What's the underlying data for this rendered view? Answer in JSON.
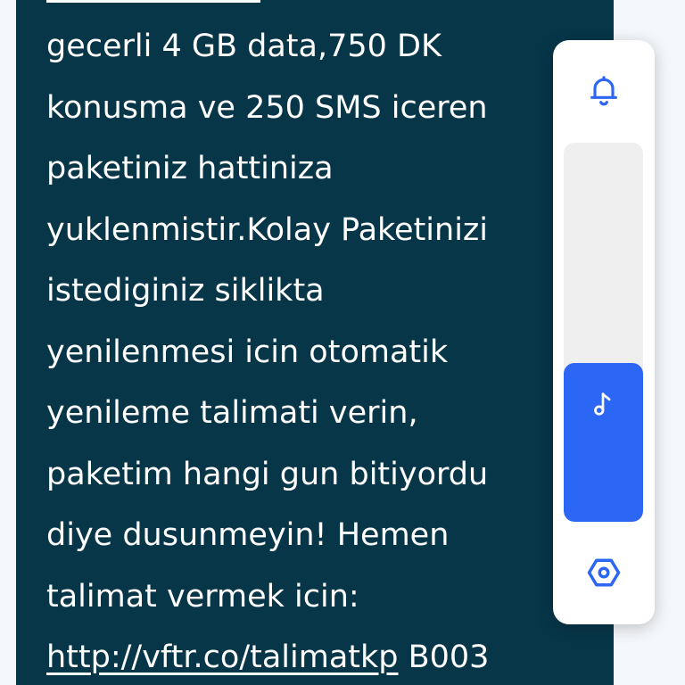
{
  "message": {
    "lines": [
      "gecerli 4 GB data,750 DK",
      "konusma ve 250 SMS iceren",
      "paketiniz hattiniza",
      "yuklenmistir.Kolay Paketinizi",
      "istediginiz siklikta",
      "yenilenmesi icin otomatik",
      "yenileme talimati verin,",
      "paketim hangi gun bitiyordu",
      "diye dusunmeyin! Hemen",
      "talimat vermek icin:"
    ],
    "link_text": "http://vftr.co/talimatkp",
    "link_suffix": " B003"
  },
  "volume_panel": {
    "top_icon": "bell-icon",
    "slider_icon": "music-note-icon",
    "bottom_icon": "settings-icon",
    "level": 0.42,
    "accent_color": "#2c66f4"
  },
  "colors": {
    "bubble_background": "#073649",
    "text": "#ffffff"
  }
}
